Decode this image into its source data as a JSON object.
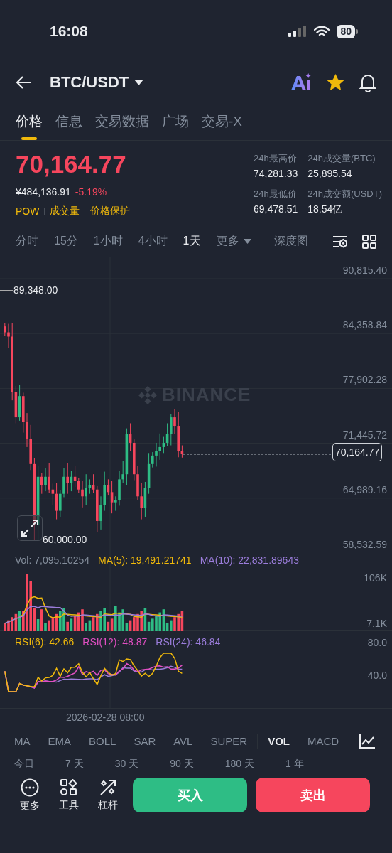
{
  "status_bar": {
    "time": "16:08",
    "battery": "80"
  },
  "header": {
    "title": "BTC/USDT"
  },
  "tabs": [
    {
      "label": "价格",
      "selected": true
    },
    {
      "label": "信息",
      "selected": false
    },
    {
      "label": "交易数据",
      "selected": false
    },
    {
      "label": "广场",
      "selected": false
    },
    {
      "label": "交易-X",
      "selected": false
    }
  ],
  "price": {
    "last": "70,164.77",
    "cny": "¥484,136.91",
    "change": "-5.19%",
    "tags": [
      "POW",
      "成交量",
      "价格保护"
    ]
  },
  "stats": [
    {
      "label": "24h最高价",
      "value": "74,281.33"
    },
    {
      "label": "24h成交量(BTC)",
      "value": "25,895.54"
    },
    {
      "label": "24h最低价",
      "value": "69,478.51"
    },
    {
      "label": "24h成交额(USDT)",
      "value": "18.54亿"
    }
  ],
  "intervals": [
    {
      "label": "分时",
      "selected": false
    },
    {
      "label": "15分",
      "selected": false
    },
    {
      "label": "1小时",
      "selected": false
    },
    {
      "label": "4小时",
      "selected": false
    },
    {
      "label": "1天",
      "selected": true
    }
  ],
  "more": "更多",
  "depth": "深度图",
  "chart": {
    "watermark": "BINANCE",
    "price_axis": [
      "90,815.40",
      "84,358.84",
      "77,902.28",
      "71,445.72",
      "64,989.16",
      "58,532.59"
    ],
    "high_marker": "89,348.00",
    "low_marker": "60,000.00",
    "last_price": "70,164.77"
  },
  "volume": {
    "legend": [
      {
        "text": "Vol: 7,095.10254",
        "color": "#848e9c"
      },
      {
        "text": "MA(5): 19,491.21741",
        "color": "#f0b90b"
      },
      {
        "text": "MA(10): 22,831.89643",
        "color": "#9b7ddb"
      }
    ],
    "axis": [
      "106K",
      "7.1K"
    ]
  },
  "rsi": {
    "legend": [
      {
        "text": "RSI(6): 42.66",
        "color": "#f0b90b"
      },
      {
        "text": "RSI(12): 48.87",
        "color": "#e04fc2"
      },
      {
        "text": "RSI(24): 46.84",
        "color": "#9b7ddb"
      }
    ],
    "axis": [
      "80.0",
      "40.0"
    ]
  },
  "time_label": "2026-02-28 08:00",
  "indicators": [
    {
      "label": "MA",
      "selected": false
    },
    {
      "label": "EMA",
      "selected": false
    },
    {
      "label": "BOLL",
      "selected": false
    },
    {
      "label": "SAR",
      "selected": false
    },
    {
      "label": "AVL",
      "selected": false
    },
    {
      "label": "SUPER",
      "selected": false
    },
    {
      "label": "VOL",
      "selected": true
    },
    {
      "label": "MACD",
      "selected": false
    }
  ],
  "ranges": [
    "今日",
    "7 天",
    "30 天",
    "90 天",
    "180 天",
    "1 年"
  ],
  "toolbar": [
    {
      "label": "更多",
      "kind": "more"
    },
    {
      "label": "工具",
      "kind": "tools"
    },
    {
      "label": "杠杆",
      "kind": "leverage"
    }
  ],
  "actions": {
    "buy": "买入",
    "sell": "卖出"
  }
}
